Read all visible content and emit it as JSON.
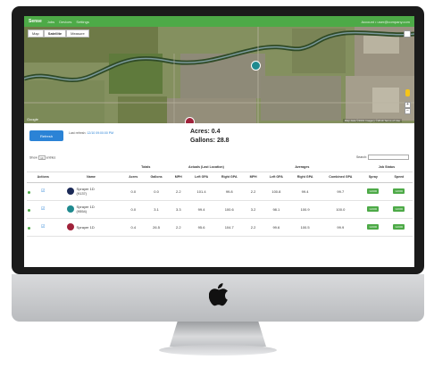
{
  "app": {
    "brand": "Sense",
    "nav": [
      "Jobs",
      "Devices",
      "Settings"
    ],
    "user": "Account • user@company.com"
  },
  "map": {
    "tabs": [
      "Map",
      "Satellite",
      "Measure"
    ],
    "google_label": "Google",
    "attribution": "Map data ©2019 Imagery ©2019 Terms of Use",
    "zoom": [
      "+",
      "−"
    ]
  },
  "controls": {
    "refresh_label": "Refresh",
    "last_refresh_label": "Last refresh:",
    "last_refresh_time": "12/10 09:00:00 PM",
    "acres_text": "Acres: 0.4",
    "gallons_text": "Gallons: 28.8",
    "show_prefix": "Show",
    "show_value": "10",
    "show_suffix": "entries",
    "search_label": "Search:"
  },
  "table": {
    "groups": [
      "Totals",
      "Actuals (Last Location)",
      "Averages",
      "Job Status"
    ],
    "headers": [
      "Actions",
      "Name",
      "Acres",
      "Gallons",
      "MPH",
      "Left GPA",
      "Right GPA",
      "MPH",
      "Left GPA",
      "Right GPA",
      "Combined GPA",
      "Spray",
      "Speed"
    ],
    "rows": [
      {
        "name": "Sprayer 1D",
        "sub": "(9137)",
        "color": "#1b2a57",
        "acres": "0.0",
        "gallons": "0.0",
        "mph": "2.2",
        "lgpa": "101.4",
        "rgpa": "99.8",
        "amph": "2.2",
        "algpa": "100.8",
        "argpa": "99.4",
        "cgpa": "99.7",
        "spray": "GOOD",
        "speed": "GOOD"
      },
      {
        "name": "Sprayer 1D",
        "sub": "(9554)",
        "color": "#1f8a8f",
        "acres": "0.0",
        "gallons": "3.1",
        "mph": "3.3",
        "lgpa": "99.4",
        "rgpa": "100.6",
        "amph": "3.2",
        "algpa": "98.1",
        "argpa": "100.9",
        "cgpa": "100.0",
        "spray": "GOOD",
        "speed": "GOOD"
      },
      {
        "name": "Sprayer 1D",
        "sub": "",
        "color": "#a0223a",
        "acres": "0.4",
        "gallons": "26.5",
        "mph": "2.2",
        "lgpa": "95.6",
        "rgpa": "104.7",
        "amph": "2.2",
        "algpa": "99.6",
        "argpa": "100.5",
        "cgpa": "99.9",
        "spray": "GOOD",
        "speed": "GOOD"
      }
    ]
  },
  "colors": {
    "brand_green": "#4daa47",
    "link_blue": "#2b83d6",
    "bezel": "#1b1b1b"
  },
  "icons": [
    "apple-logo-icon",
    "edit-icon",
    "fullscreen-icon",
    "pegman-icon"
  ]
}
